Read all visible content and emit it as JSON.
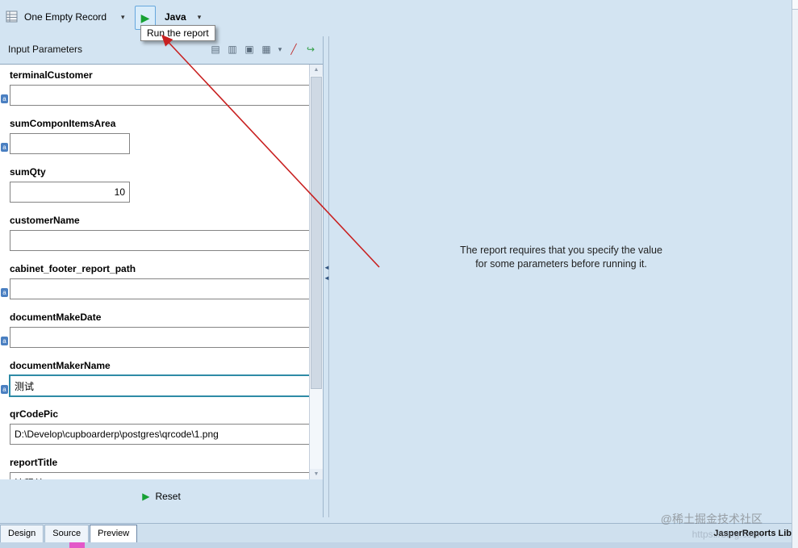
{
  "colors": {
    "background": "#d3e4f2",
    "focus_border": "#2e8ba6",
    "run_green": "#16a134",
    "arrow_red": "#c82020",
    "taskbar_pink": "#e358c8"
  },
  "toolbar": {
    "record_selector_label": "One Empty Record",
    "language_label": "Java",
    "run_tooltip": "Run the report"
  },
  "parameters_panel": {
    "title": "Input Parameters",
    "toolbar_icons": [
      {
        "name": "form-icon",
        "glyph": "▤"
      },
      {
        "name": "fields-icon",
        "glyph": "▥"
      },
      {
        "name": "values-icon",
        "glyph": "▣"
      },
      {
        "name": "keyboard-icon",
        "glyph": "▦"
      },
      {
        "name": "dropdown-arrow-icon",
        "glyph": "▾",
        "small": true
      },
      {
        "name": "clear-parameters-icon",
        "glyph": "╱",
        "color": "#c03030"
      },
      {
        "name": "open-report-icon",
        "glyph": "↪",
        "color": "#2f9e44"
      }
    ],
    "fields": [
      {
        "label": "terminalCustomer",
        "value": "",
        "size": "wide",
        "has_icon": true
      },
      {
        "label": "sumComponItemsArea",
        "value": "",
        "size": "small",
        "has_icon": true
      },
      {
        "label": "sumQty",
        "value": "10",
        "size": "small",
        "has_icon": false,
        "align": "right"
      },
      {
        "label": "customerName",
        "value": "",
        "size": "wide",
        "has_icon": false
      },
      {
        "label": "cabinet_footer_report_path",
        "value": "",
        "size": "wide",
        "has_icon": true
      },
      {
        "label": "documentMakeDate",
        "value": "",
        "size": "wide",
        "has_icon": true
      },
      {
        "label": "documentMakerName",
        "value": "测试",
        "size": "wide",
        "has_icon": true,
        "focused": true
      },
      {
        "label": "qrCodePic",
        "value": "D:\\Develop\\cupboarderp\\postgres\\qrcode\\1.png",
        "size": "wide",
        "has_icon": false
      },
      {
        "label": "reportTitle",
        "value": "流程单",
        "size": "wide",
        "has_icon": false
      }
    ],
    "reset_label": "Reset"
  },
  "preview_panel": {
    "message_line1": "The report requires that you specify the value",
    "message_line2": "for some parameters before running it."
  },
  "tabs": [
    {
      "label": "Design",
      "active": false
    },
    {
      "label": "Source",
      "active": false
    },
    {
      "label": "Preview",
      "active": true
    }
  ],
  "status_right": "JasperReports Lib",
  "watermark": {
    "line1": "@稀土掘金技术社区",
    "line2": "https://blog.csdn"
  }
}
